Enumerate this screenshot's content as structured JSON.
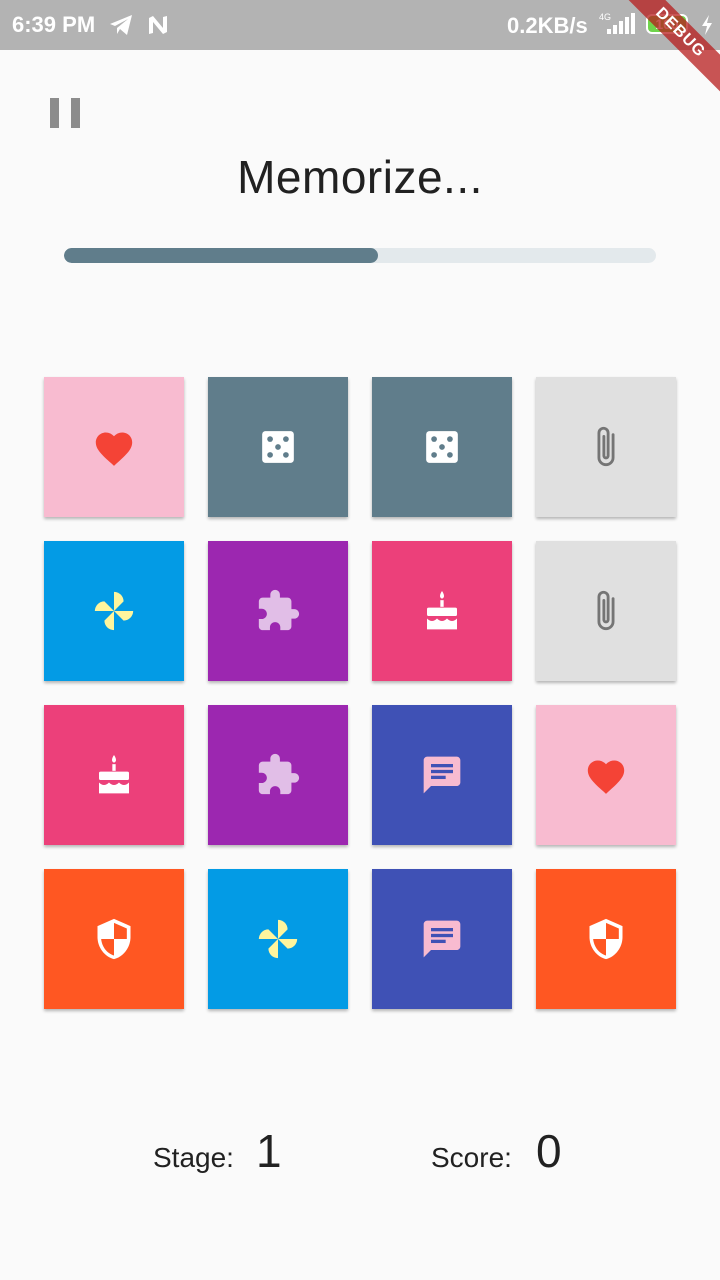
{
  "status_bar": {
    "time": "6:39 PM",
    "speed": "0.2KB/s",
    "network": "4G",
    "battery": "100",
    "icons": [
      "telegram-icon",
      "n-icon",
      "signal-icon",
      "battery-icon",
      "charging-bolt-icon"
    ]
  },
  "debug_banner": "DEBUG",
  "header": {
    "title": "Memorize...",
    "progress": 0.53
  },
  "tiles": [
    {
      "icon": "heart-icon",
      "bg": "#f8bbd0",
      "fg": "#f44336"
    },
    {
      "icon": "dice-icon",
      "bg": "#607d8b",
      "fg": "#ffffff"
    },
    {
      "icon": "dice-icon",
      "bg": "#607d8b",
      "fg": "#ffffff"
    },
    {
      "icon": "paperclip-icon",
      "bg": "#e0e0e0",
      "fg": "#757575"
    },
    {
      "icon": "pinwheel-icon",
      "bg": "#039be5",
      "fg": "#fff59d"
    },
    {
      "icon": "puzzle-icon",
      "bg": "#9c27b0",
      "fg": "#e1bee7"
    },
    {
      "icon": "cake-icon",
      "bg": "#ec407a",
      "fg": "#ffffff"
    },
    {
      "icon": "paperclip-icon",
      "bg": "#e0e0e0",
      "fg": "#757575"
    },
    {
      "icon": "cake-icon",
      "bg": "#ec407a",
      "fg": "#ffffff"
    },
    {
      "icon": "puzzle-icon",
      "bg": "#9c27b0",
      "fg": "#e1bee7"
    },
    {
      "icon": "chat-icon",
      "bg": "#3f51b5",
      "fg": "#f8bbd0"
    },
    {
      "icon": "heart-icon",
      "bg": "#f8bbd0",
      "fg": "#f44336"
    },
    {
      "icon": "shield-icon",
      "bg": "#ff5722",
      "fg": "#ffffff"
    },
    {
      "icon": "pinwheel-icon",
      "bg": "#039be5",
      "fg": "#fff59d"
    },
    {
      "icon": "chat-icon",
      "bg": "#3f51b5",
      "fg": "#f8bbd0"
    },
    {
      "icon": "shield-icon",
      "bg": "#ff5722",
      "fg": "#ffffff"
    }
  ],
  "footer": {
    "stage_label": "Stage:",
    "stage_value": "1",
    "score_label": "Score:",
    "score_value": "0"
  }
}
